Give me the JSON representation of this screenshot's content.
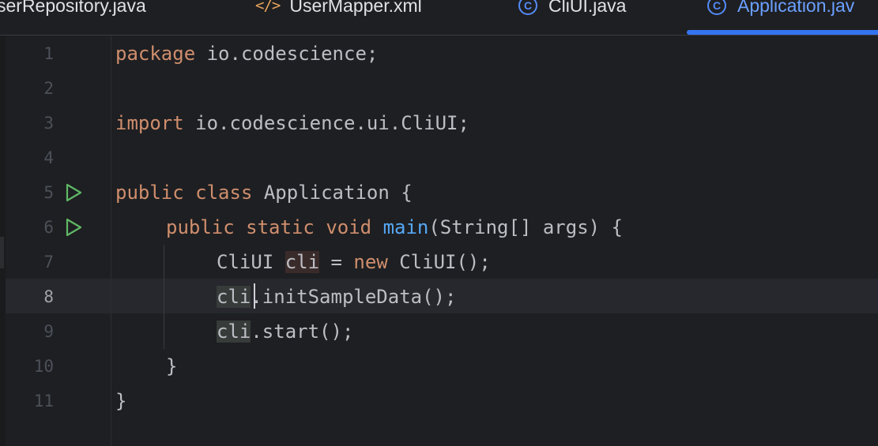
{
  "tabs": [
    {
      "label": "serRepository.java",
      "icon": "java-class-icon",
      "active": false
    },
    {
      "label": "UserMapper.xml",
      "icon": "xml-file-icon",
      "active": false
    },
    {
      "label": "CliUI.java",
      "icon": "java-class-icon",
      "active": false
    },
    {
      "label": "Application.jav",
      "icon": "java-class-icon",
      "active": true
    }
  ],
  "icons": {
    "xml_glyph": "</>",
    "class_glyph": "C",
    "run": "run-gutter-icon"
  },
  "colors": {
    "background": "#1e1f22",
    "keyword": "#cf8e6d",
    "method": "#56a8f5",
    "text": "#bcbec4",
    "run_icon": "#5fb865",
    "active_tab": "#6ba0ff",
    "tab_underline": "#3574f0"
  },
  "editor": {
    "current_line": "8",
    "line_numbers": [
      "1",
      "2",
      "3",
      "4",
      "5",
      "6",
      "7",
      "8",
      "9",
      "10",
      "11"
    ],
    "lines": {
      "l1": {
        "kw": "package",
        "rest": " io.codescience;"
      },
      "l3": {
        "kw": "import",
        "rest": " io.codescience.ui.CliUI;"
      },
      "l5": {
        "kw1": "public",
        "kw2": "class",
        "rest": " Application {"
      },
      "l6": {
        "kw1": "public",
        "kw2": "static",
        "kw3": "void",
        "fn": "main",
        "rest": "(String[] args) {"
      },
      "l7": {
        "type": "CliUI",
        "var": "cli",
        "eq": " = ",
        "kw": "new",
        "rest": " CliUI();"
      },
      "l8": {
        "var": "cli",
        "rest": ".initSampleData();"
      },
      "l9": {
        "var": "cli",
        "rest": ".start();"
      },
      "l10": {
        "text": "}"
      },
      "l11": {
        "text": "}"
      }
    }
  }
}
